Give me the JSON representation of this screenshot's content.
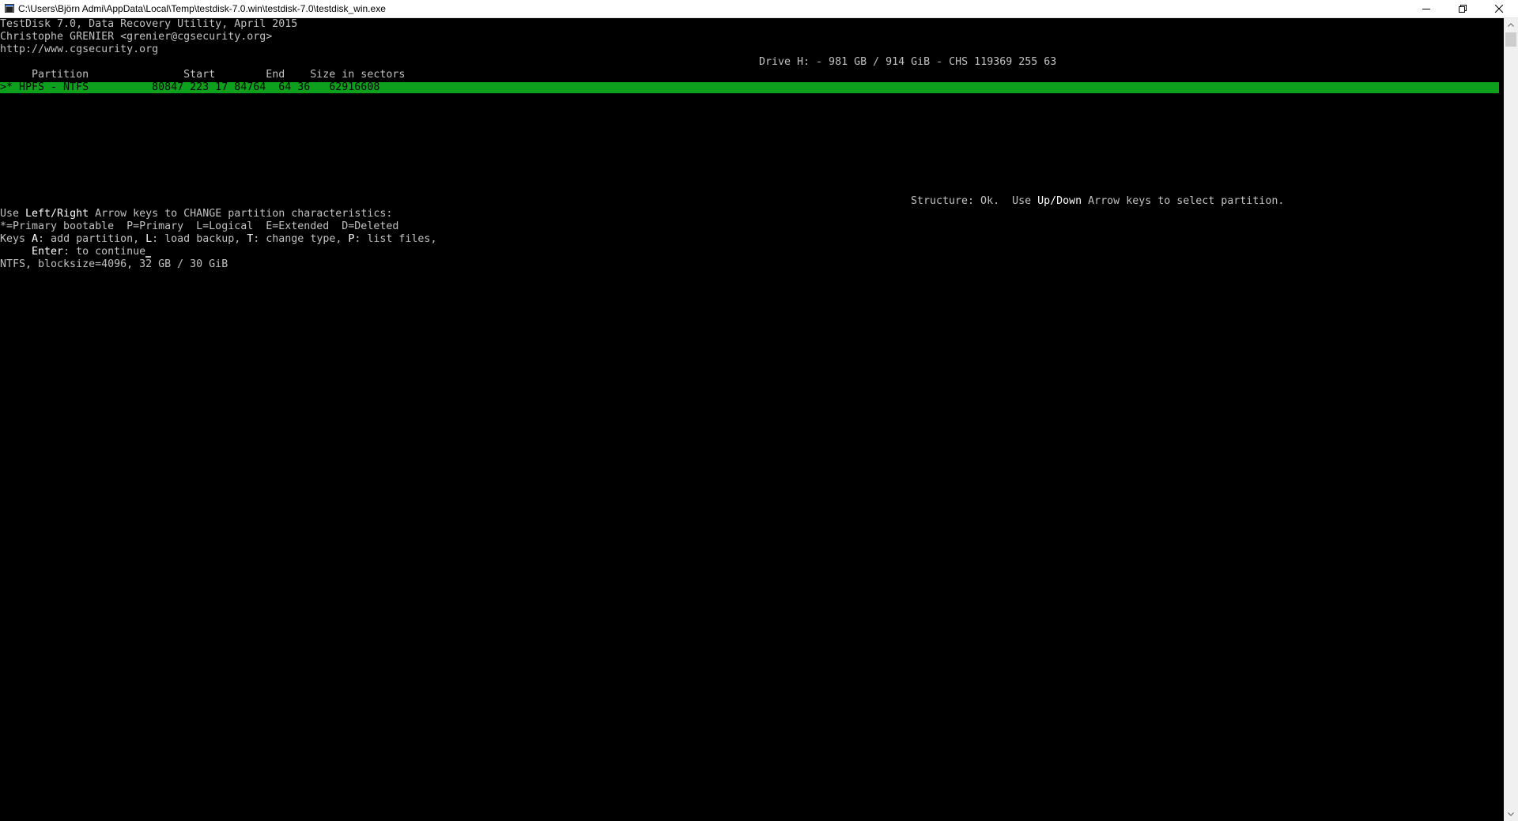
{
  "window": {
    "title": "C:\\Users\\Björn Admi\\AppData\\Local\\Temp\\testdisk-7.0.win\\testdisk-7.0\\testdisk_win.exe"
  },
  "icons": {
    "app": "console-app-icon",
    "minimize": "minimize-icon",
    "restore": "restore-icon",
    "close": "close-icon",
    "scroll_up": "chevron-up-icon",
    "scroll_down": "chevron-down-icon"
  },
  "colors": {
    "background": "#000000",
    "text": "#c0c0c0",
    "bright_text": "#ffffff",
    "selection": "#0ca01c"
  },
  "console": {
    "header": {
      "line1": "TestDisk 7.0, Data Recovery Utility, April 2015",
      "line2": "Christophe GRENIER <grenier@cgsecurity.org>",
      "line3": "http://www.cgsecurity.org"
    },
    "drive_info": "Drive H: - 981 GB / 914 GiB - CHS 119369 255 63",
    "table_header": "     Partition               Start        End    Size in sectors",
    "partitions": [
      {
        "row": ">* HPFS - NTFS          80847 223 17 84764  64 36   62916608"
      }
    ],
    "structure": {
      "prefix": "Structure: Ok.  Use ",
      "key": "Up/Down",
      "suffix": " Arrow keys to select partition."
    },
    "help": {
      "l1_a": "Use ",
      "l1_key": "Left/Right",
      "l1_b": " Arrow keys to CHANGE partition characteristics:",
      "l2": "*=Primary bootable  P=Primary  L=Logical  E=Extended  D=Deleted",
      "l3_a": "Keys ",
      "l3_k1": "A",
      "l3_b": ": add partition, ",
      "l3_k2": "L",
      "l3_c": ": load backup, ",
      "l3_k3": "T",
      "l3_d": ": change type, ",
      "l3_k4": "P",
      "l3_e": ": list files,",
      "l4_indent": "     ",
      "l4_key": "Enter",
      "l4_rest": ": to continue"
    },
    "status": "NTFS, blocksize=4096, 32 GB / 30 GiB"
  }
}
